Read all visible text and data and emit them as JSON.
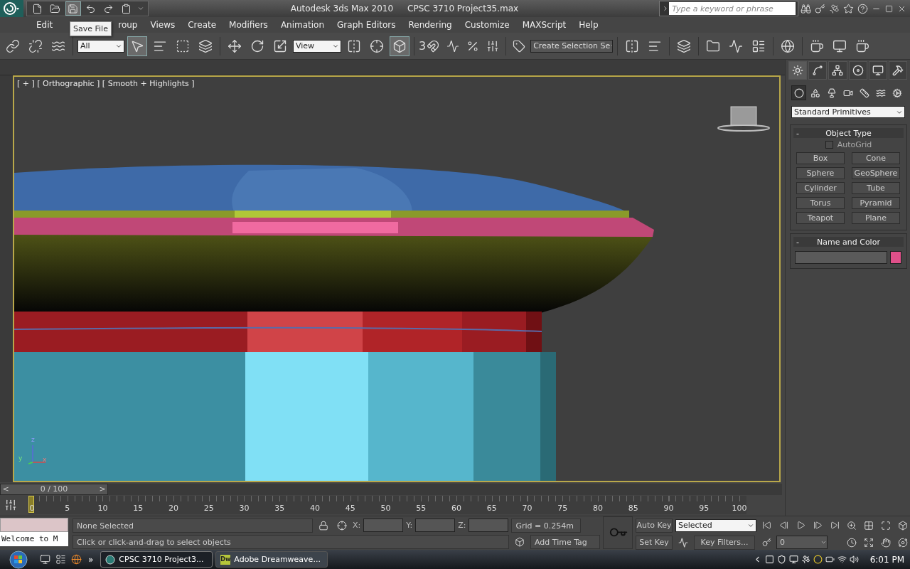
{
  "title_bar": {
    "app_title": "Autodesk 3ds Max  2010",
    "file_title": "CPSC 3710 Project35.max",
    "search": {
      "placeholder": "Type a keyword or phrase"
    }
  },
  "tooltip": "Save File",
  "menu": [
    "Edit",
    "roup",
    "Views",
    "Create",
    "Modifiers",
    "Animation",
    "Graph Editors",
    "Rendering",
    "Customize",
    "MAXScript",
    "Help"
  ],
  "main_toolbar": {
    "selection_filter": "All",
    "reference_coord": "View",
    "snap_label": "3",
    "named_selection": "Create Selection Se"
  },
  "viewport": {
    "label": "[ + ] [ Orthographic ] [ Smooth + Highlights ]",
    "axes": [
      "z",
      "y",
      "x"
    ]
  },
  "command_panel": {
    "tabs": [
      {
        "selected": true
      },
      {
        "selected": false
      },
      {
        "selected": false
      },
      {
        "selected": false
      },
      {
        "selected": false
      },
      {
        "selected": false
      }
    ],
    "categories": [
      {
        "selected": true
      },
      {
        "selected": false
      },
      {
        "selected": false
      },
      {
        "selected": false
      },
      {
        "selected": false
      },
      {
        "selected": false
      },
      {
        "selected": false
      }
    ],
    "dropdown": "Standard Primitives",
    "object_type": {
      "toggle": "-",
      "title": "Object Type",
      "autogrid": {
        "label": "AutoGrid",
        "checked": false
      },
      "buttons": [
        "Box",
        "Cone",
        "Sphere",
        "GeoSphere",
        "Cylinder",
        "Tube",
        "Torus",
        "Pyramid",
        "Teapot",
        "Plane"
      ]
    },
    "name_and_color": {
      "toggle": "-",
      "title": "Name and Color",
      "color": "#e0508a"
    }
  },
  "time_slider": {
    "prev": "<",
    "position": "0 / 100",
    "next": ">"
  },
  "track_bar": {
    "ticks": [
      "0",
      "5",
      "10",
      "15",
      "20",
      "25",
      "30",
      "35",
      "40",
      "45",
      "50",
      "55",
      "60",
      "65",
      "70",
      "75",
      "80",
      "85",
      "90",
      "95",
      "100"
    ]
  },
  "listener": {
    "text": "Welcome to M"
  },
  "status": {
    "selection": "None Selected",
    "x_label": "X:",
    "y_label": "Y:",
    "z_label": "Z:",
    "grid": "Grid = 0.254m",
    "prompt": "Click or click-and-drag to select objects",
    "time_tag": "Add Time Tag"
  },
  "animation": {
    "auto_key": "Auto Key",
    "key_mode": "Selected",
    "set_key": "Set Key",
    "key_filters": "Key Filters...",
    "frame": "0"
  },
  "taskbar": {
    "more": "»",
    "tasks": [
      {
        "kind": "max",
        "label": "CPSC 3710 Project3...",
        "selected": true
      },
      {
        "kind": "dw",
        "icon_text": "Dw",
        "label": "Adobe Dreamweave...",
        "selected": false
      }
    ],
    "clock": "6:01 PM"
  }
}
